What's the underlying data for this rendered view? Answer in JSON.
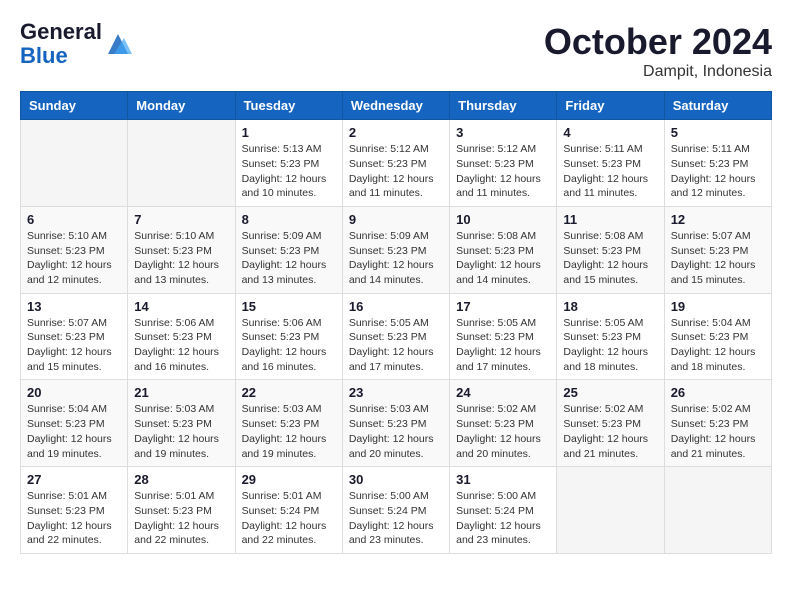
{
  "header": {
    "logo_general": "General",
    "logo_blue": "Blue",
    "month_title": "October 2024",
    "location": "Dampit, Indonesia"
  },
  "days_of_week": [
    "Sunday",
    "Monday",
    "Tuesday",
    "Wednesday",
    "Thursday",
    "Friday",
    "Saturday"
  ],
  "weeks": [
    [
      {
        "day": "",
        "info": ""
      },
      {
        "day": "",
        "info": ""
      },
      {
        "day": "1",
        "info": "Sunrise: 5:13 AM\nSunset: 5:23 PM\nDaylight: 12 hours\nand 10 minutes."
      },
      {
        "day": "2",
        "info": "Sunrise: 5:12 AM\nSunset: 5:23 PM\nDaylight: 12 hours\nand 11 minutes."
      },
      {
        "day": "3",
        "info": "Sunrise: 5:12 AM\nSunset: 5:23 PM\nDaylight: 12 hours\nand 11 minutes."
      },
      {
        "day": "4",
        "info": "Sunrise: 5:11 AM\nSunset: 5:23 PM\nDaylight: 12 hours\nand 11 minutes."
      },
      {
        "day": "5",
        "info": "Sunrise: 5:11 AM\nSunset: 5:23 PM\nDaylight: 12 hours\nand 12 minutes."
      }
    ],
    [
      {
        "day": "6",
        "info": "Sunrise: 5:10 AM\nSunset: 5:23 PM\nDaylight: 12 hours\nand 12 minutes."
      },
      {
        "day": "7",
        "info": "Sunrise: 5:10 AM\nSunset: 5:23 PM\nDaylight: 12 hours\nand 13 minutes."
      },
      {
        "day": "8",
        "info": "Sunrise: 5:09 AM\nSunset: 5:23 PM\nDaylight: 12 hours\nand 13 minutes."
      },
      {
        "day": "9",
        "info": "Sunrise: 5:09 AM\nSunset: 5:23 PM\nDaylight: 12 hours\nand 14 minutes."
      },
      {
        "day": "10",
        "info": "Sunrise: 5:08 AM\nSunset: 5:23 PM\nDaylight: 12 hours\nand 14 minutes."
      },
      {
        "day": "11",
        "info": "Sunrise: 5:08 AM\nSunset: 5:23 PM\nDaylight: 12 hours\nand 15 minutes."
      },
      {
        "day": "12",
        "info": "Sunrise: 5:07 AM\nSunset: 5:23 PM\nDaylight: 12 hours\nand 15 minutes."
      }
    ],
    [
      {
        "day": "13",
        "info": "Sunrise: 5:07 AM\nSunset: 5:23 PM\nDaylight: 12 hours\nand 15 minutes."
      },
      {
        "day": "14",
        "info": "Sunrise: 5:06 AM\nSunset: 5:23 PM\nDaylight: 12 hours\nand 16 minutes."
      },
      {
        "day": "15",
        "info": "Sunrise: 5:06 AM\nSunset: 5:23 PM\nDaylight: 12 hours\nand 16 minutes."
      },
      {
        "day": "16",
        "info": "Sunrise: 5:05 AM\nSunset: 5:23 PM\nDaylight: 12 hours\nand 17 minutes."
      },
      {
        "day": "17",
        "info": "Sunrise: 5:05 AM\nSunset: 5:23 PM\nDaylight: 12 hours\nand 17 minutes."
      },
      {
        "day": "18",
        "info": "Sunrise: 5:05 AM\nSunset: 5:23 PM\nDaylight: 12 hours\nand 18 minutes."
      },
      {
        "day": "19",
        "info": "Sunrise: 5:04 AM\nSunset: 5:23 PM\nDaylight: 12 hours\nand 18 minutes."
      }
    ],
    [
      {
        "day": "20",
        "info": "Sunrise: 5:04 AM\nSunset: 5:23 PM\nDaylight: 12 hours\nand 19 minutes."
      },
      {
        "day": "21",
        "info": "Sunrise: 5:03 AM\nSunset: 5:23 PM\nDaylight: 12 hours\nand 19 minutes."
      },
      {
        "day": "22",
        "info": "Sunrise: 5:03 AM\nSunset: 5:23 PM\nDaylight: 12 hours\nand 19 minutes."
      },
      {
        "day": "23",
        "info": "Sunrise: 5:03 AM\nSunset: 5:23 PM\nDaylight: 12 hours\nand 20 minutes."
      },
      {
        "day": "24",
        "info": "Sunrise: 5:02 AM\nSunset: 5:23 PM\nDaylight: 12 hours\nand 20 minutes."
      },
      {
        "day": "25",
        "info": "Sunrise: 5:02 AM\nSunset: 5:23 PM\nDaylight: 12 hours\nand 21 minutes."
      },
      {
        "day": "26",
        "info": "Sunrise: 5:02 AM\nSunset: 5:23 PM\nDaylight: 12 hours\nand 21 minutes."
      }
    ],
    [
      {
        "day": "27",
        "info": "Sunrise: 5:01 AM\nSunset: 5:23 PM\nDaylight: 12 hours\nand 22 minutes."
      },
      {
        "day": "28",
        "info": "Sunrise: 5:01 AM\nSunset: 5:23 PM\nDaylight: 12 hours\nand 22 minutes."
      },
      {
        "day": "29",
        "info": "Sunrise: 5:01 AM\nSunset: 5:24 PM\nDaylight: 12 hours\nand 22 minutes."
      },
      {
        "day": "30",
        "info": "Sunrise: 5:00 AM\nSunset: 5:24 PM\nDaylight: 12 hours\nand 23 minutes."
      },
      {
        "day": "31",
        "info": "Sunrise: 5:00 AM\nSunset: 5:24 PM\nDaylight: 12 hours\nand 23 minutes."
      },
      {
        "day": "",
        "info": ""
      },
      {
        "day": "",
        "info": ""
      }
    ]
  ]
}
